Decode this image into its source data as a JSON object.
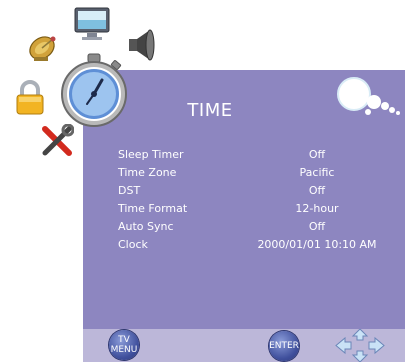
{
  "menu": {
    "title": "TIME",
    "items": [
      {
        "label": "Sleep Timer",
        "value": "Off"
      },
      {
        "label": "Time Zone",
        "value": "Pacific"
      },
      {
        "label": "DST",
        "value": "Off"
      },
      {
        "label": "Time Format",
        "value": "12-hour"
      },
      {
        "label": "Auto Sync",
        "value": "Off"
      },
      {
        "label": "Clock",
        "value": "2000/01/01 10:10 AM"
      }
    ]
  },
  "footer": {
    "menu_button_line1": "TV",
    "menu_button_line2": "MENU",
    "enter_button": "ENTER"
  },
  "icons": [
    "satellite-dish-icon",
    "monitor-icon",
    "speaker-icon",
    "padlock-icon",
    "stopwatch-icon",
    "tools-icon",
    "bubbles-icon",
    "arrow-keys-icon"
  ],
  "colors": {
    "panel": "#8d86c0",
    "footer": "#bcb7d9",
    "text": "#ffffff"
  }
}
